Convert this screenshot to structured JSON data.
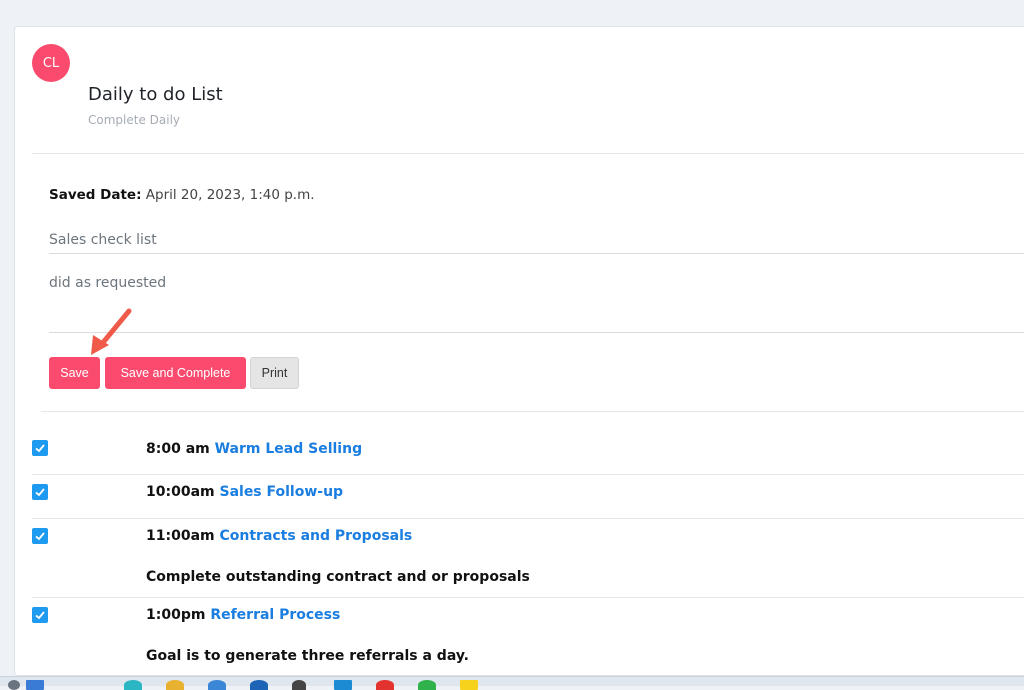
{
  "avatar": {
    "initials": "CL"
  },
  "header": {
    "title": "Daily to do List",
    "subtitle": "Complete Daily"
  },
  "saved": {
    "label": "Saved Date:",
    "value": "April 20, 2023, 1:40 p.m."
  },
  "fields": {
    "checklist_name": "Sales check list",
    "notes": "did as requested"
  },
  "buttons": {
    "save": "Save",
    "save_complete": "Save and Complete",
    "print": "Print"
  },
  "tasks": [
    {
      "time": "8:00 am",
      "name": "Warm Lead Selling",
      "checked": true,
      "note": ""
    },
    {
      "time": "10:00am",
      "name": "Sales Follow-up",
      "checked": true,
      "note": ""
    },
    {
      "time": "11:00am",
      "name": "Contracts and Proposals",
      "checked": true,
      "note": "Complete outstanding contract and or proposals"
    },
    {
      "time": "1:00pm",
      "name": "Referral Process",
      "checked": true,
      "note": "Goal is to generate three referrals a day."
    }
  ],
  "colors": {
    "accent": "#fa4b6e",
    "checkbox": "#1e9af0",
    "link": "#1a7de0"
  }
}
